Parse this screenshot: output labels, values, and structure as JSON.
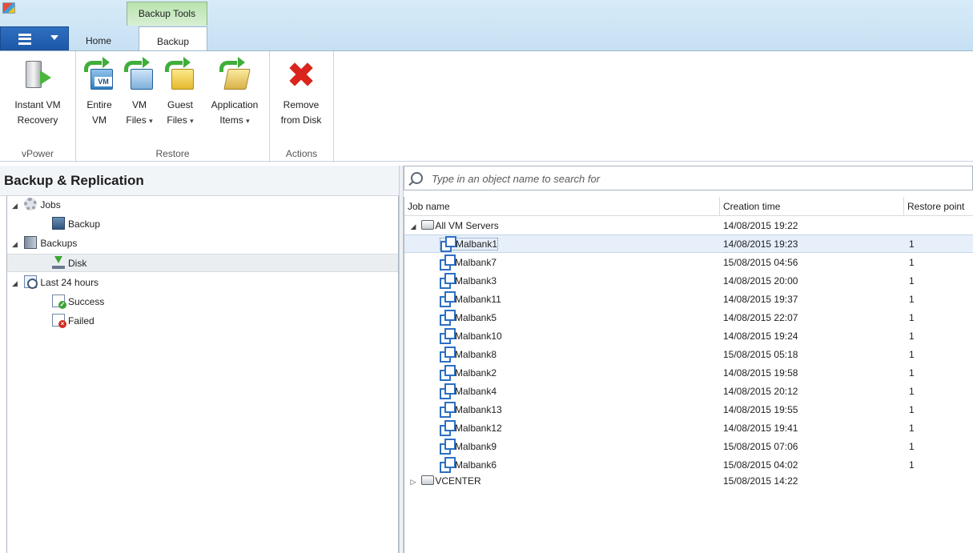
{
  "window": {
    "contextual_tab_group": "Backup Tools"
  },
  "tabs": {
    "home": "Home",
    "backup": "Backup"
  },
  "ribbon": {
    "groups": {
      "vpower": "vPower",
      "restore": "Restore",
      "actions": "Actions"
    },
    "buttons": {
      "instant_vm_recovery": [
        "Instant VM",
        "Recovery"
      ],
      "entire_vm": [
        "Entire",
        "VM"
      ],
      "vm_files": [
        "VM",
        "Files"
      ],
      "guest_files": [
        "Guest",
        "Files"
      ],
      "application_items": [
        "Application",
        "Items"
      ],
      "remove_from_disk": [
        "Remove",
        "from Disk"
      ]
    },
    "dropdown_glyph": "▾",
    "vm_tag": "VM",
    "remove_glyph": "✖"
  },
  "left": {
    "title": "Backup & Replication",
    "tree": {
      "jobs": "Jobs",
      "jobs_backup": "Backup",
      "backups": "Backups",
      "disk": "Disk",
      "last24": "Last 24 hours",
      "success": "Success",
      "failed": "Failed"
    },
    "expand_glyph": "◢"
  },
  "search": {
    "placeholder": "Type in an object name to search for"
  },
  "grid": {
    "columns": [
      "Job name",
      "Creation time",
      "Restore point"
    ],
    "expanded_glyph": "◢",
    "collapsed_glyph": "▷",
    "groups": [
      {
        "name": "All VM Servers",
        "time": "14/08/2015 19:22"
      },
      {
        "name": "VCENTER",
        "time": "15/08/2015 14:22"
      }
    ],
    "rows": [
      {
        "name": "Malbank1",
        "time": "14/08/2015 19:23",
        "rp": "1"
      },
      {
        "name": "Malbank7",
        "time": "15/08/2015 04:56",
        "rp": "1"
      },
      {
        "name": "Malbank3",
        "time": "14/08/2015 20:00",
        "rp": "1"
      },
      {
        "name": "Malbank11",
        "time": "14/08/2015 19:37",
        "rp": "1"
      },
      {
        "name": "Malbank5",
        "time": "14/08/2015 22:07",
        "rp": "1"
      },
      {
        "name": "Malbank10",
        "time": "14/08/2015 19:24",
        "rp": "1"
      },
      {
        "name": "Malbank8",
        "time": "15/08/2015 05:18",
        "rp": "1"
      },
      {
        "name": "Malbank2",
        "time": "14/08/2015 19:58",
        "rp": "1"
      },
      {
        "name": "Malbank4",
        "time": "14/08/2015 20:12",
        "rp": "1"
      },
      {
        "name": "Malbank13",
        "time": "14/08/2015 19:55",
        "rp": "1"
      },
      {
        "name": "Malbank12",
        "time": "14/08/2015 19:41",
        "rp": "1"
      },
      {
        "name": "Malbank9",
        "time": "15/08/2015 07:06",
        "rp": "1"
      },
      {
        "name": "Malbank6",
        "time": "15/08/2015 04:02",
        "rp": "1"
      }
    ]
  }
}
